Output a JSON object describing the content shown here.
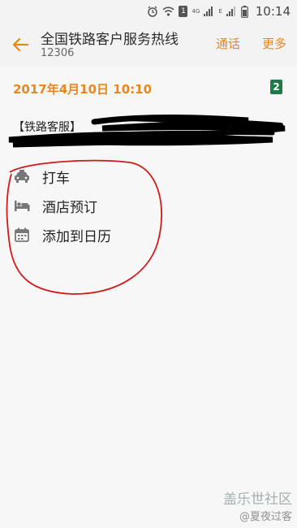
{
  "status_bar": {
    "network_4g": "4G",
    "network_4g2g": "4G 2G",
    "network_e": "E",
    "sim_slot": "1",
    "time": "10:14"
  },
  "app_bar": {
    "title": "全国铁路客户服务热线",
    "subtitle": "12306",
    "call_label": "通话",
    "more_label": "更多"
  },
  "message": {
    "date": "2017年4月10日  10:10",
    "sim_badge": "2",
    "text_visible": "【铁路客服】"
  },
  "smart_actions": [
    {
      "label": "打车",
      "icon": "taxi-icon"
    },
    {
      "label": "酒店预订",
      "icon": "bed-icon"
    },
    {
      "label": "添加到日历",
      "icon": "calendar-icon"
    }
  ],
  "watermark": {
    "logo": "盖乐世社区",
    "user": "@夏夜过客"
  },
  "colors": {
    "accent": "#e8871e",
    "annotation": "#d11a1a",
    "sim_green": "#1e7a46"
  }
}
